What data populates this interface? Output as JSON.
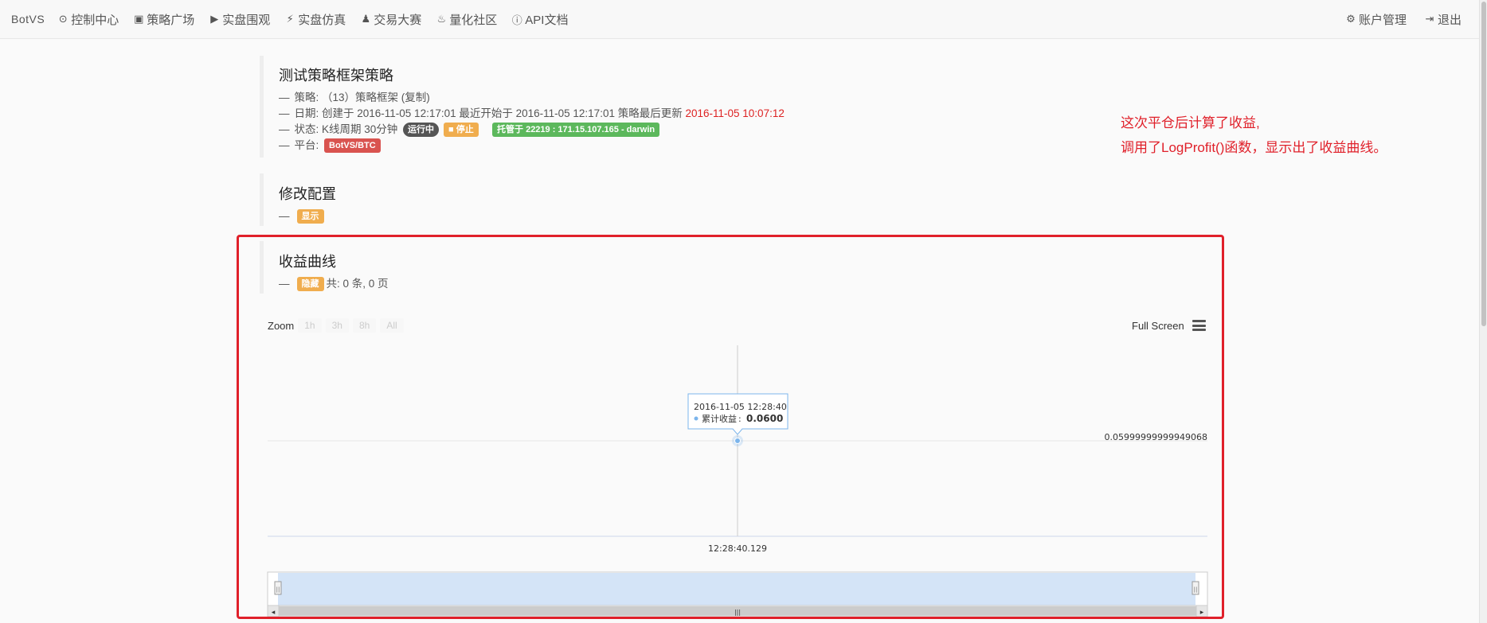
{
  "nav": {
    "brand": "BotVS",
    "items": [
      {
        "icon": "dashboard-icon",
        "glyph": "⊙",
        "label": "控制中心"
      },
      {
        "icon": "cart-icon",
        "glyph": "▣",
        "label": "策略广场"
      },
      {
        "icon": "play-circle-icon",
        "glyph": "▶",
        "label": "实盘围观"
      },
      {
        "icon": "bolt-icon",
        "glyph": "⚡",
        "label": "实盘仿真"
      },
      {
        "icon": "chess-icon",
        "glyph": "♟",
        "label": "交易大赛"
      },
      {
        "icon": "fire-icon",
        "glyph": "♨",
        "label": "量化社区"
      },
      {
        "icon": "info-icon",
        "glyph": "ⓘ",
        "label": "API文档"
      }
    ],
    "right_items": [
      {
        "icon": "gear-icon",
        "glyph": "⚙",
        "label": "账户管理"
      },
      {
        "icon": "logout-icon",
        "glyph": "⇥",
        "label": "退出"
      }
    ]
  },
  "strategy": {
    "title": "测试策略框架策略",
    "strategy_line": "策略: （13）策略框架 (复制)",
    "date_prefix": "日期: 创建于 2016-11-05 12:17:01 最近开始于 2016-11-05 12:17:01 策略最后更新",
    "date_updated": "2016-11-05 10:07:12",
    "status_prefix": "状态: K线周期 30分钟",
    "status_running": "运行中",
    "stop_label": "■ 停止",
    "host_label": "托管于 22219 : 171.15.107.165 - darwin",
    "platform_prefix": "平台:",
    "platform_label": "BotVS/BTC"
  },
  "config": {
    "title": "修改配置",
    "show_label": "显示"
  },
  "profit": {
    "title": "收益曲线",
    "hide_label": "隐藏",
    "count_text": "共: 0 条, 0 页"
  },
  "annotation": {
    "line1": "这次平仓后计算了收益,",
    "line2": "调用了LogProfit()函数，显示出了收益曲线。"
  },
  "chart_toolbar": {
    "zoom_label": "Zoom",
    "zoom_buttons": [
      "1h",
      "3h",
      "8h",
      "All"
    ],
    "fullscreen_label": "Full Screen"
  },
  "chart_data": {
    "type": "line",
    "series": [
      {
        "name": "累计收益",
        "points": [
          {
            "x": "12:28:40.129",
            "y": 0.0599999999949068
          }
        ]
      }
    ],
    "x_tick": "12:28:40.129",
    "y_tick": "0.05999999999949068",
    "tooltip_time": "2016-11-05 12:28:40",
    "tooltip_series": "累计收益",
    "tooltip_value": "0.0600",
    "navigator_left_handle": "||",
    "navigator_right_handle": "||",
    "scroll_left": "◂",
    "scroll_right": "▸",
    "scroll_grip": "|||",
    "colors": {
      "series": "#7cb5ec",
      "navigator": "#d4e4f7"
    }
  }
}
